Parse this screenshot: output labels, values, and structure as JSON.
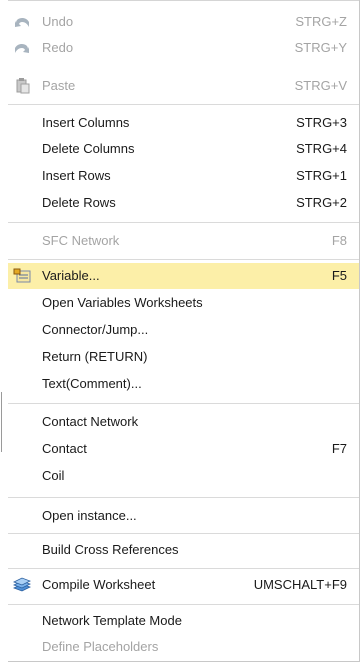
{
  "menu": {
    "items": [
      {
        "label": "Undo",
        "shortcut": "STRG+Z",
        "enabled": false,
        "icon": "undo-icon"
      },
      {
        "label": "Redo",
        "shortcut": "STRG+Y",
        "enabled": false,
        "icon": "redo-icon"
      },
      {
        "label": "Paste",
        "shortcut": "STRG+V",
        "enabled": false,
        "icon": "paste-icon"
      },
      {
        "label": "Insert Columns",
        "shortcut": "STRG+3",
        "enabled": true
      },
      {
        "label": "Delete Columns",
        "shortcut": "STRG+4",
        "enabled": true
      },
      {
        "label": "Insert Rows",
        "shortcut": "STRG+1",
        "enabled": true
      },
      {
        "label": "Delete Rows",
        "shortcut": "STRG+2",
        "enabled": true
      },
      {
        "label": "SFC Network",
        "shortcut": "F8",
        "enabled": false
      },
      {
        "label": "Variable...",
        "shortcut": "F5",
        "enabled": true,
        "highlighted": true,
        "icon": "variable-icon"
      },
      {
        "label": "Open Variables Worksheets",
        "shortcut": "",
        "enabled": true
      },
      {
        "label": "Connector/Jump...",
        "shortcut": "",
        "enabled": true
      },
      {
        "label": "Return (RETURN)",
        "shortcut": "",
        "enabled": true
      },
      {
        "label": "Text(Comment)...",
        "shortcut": "",
        "enabled": true
      },
      {
        "label": "Contact Network",
        "shortcut": "",
        "enabled": true
      },
      {
        "label": "Contact",
        "shortcut": "F7",
        "enabled": true
      },
      {
        "label": "Coil",
        "shortcut": "",
        "enabled": true
      },
      {
        "label": "Open instance...",
        "shortcut": "",
        "enabled": true
      },
      {
        "label": "Build Cross References",
        "shortcut": "",
        "enabled": true
      },
      {
        "label": "Compile Worksheet",
        "shortcut": "UMSCHALT+F9",
        "enabled": true,
        "icon": "compile-icon"
      },
      {
        "label": "Network Template Mode",
        "shortcut": "",
        "enabled": true
      },
      {
        "label": "Define Placeholders",
        "shortcut": "",
        "enabled": false
      }
    ]
  },
  "colors": {
    "highlight": "#fcefa8",
    "disabled_text": "#a4a4a4",
    "separator": "#dadada"
  }
}
